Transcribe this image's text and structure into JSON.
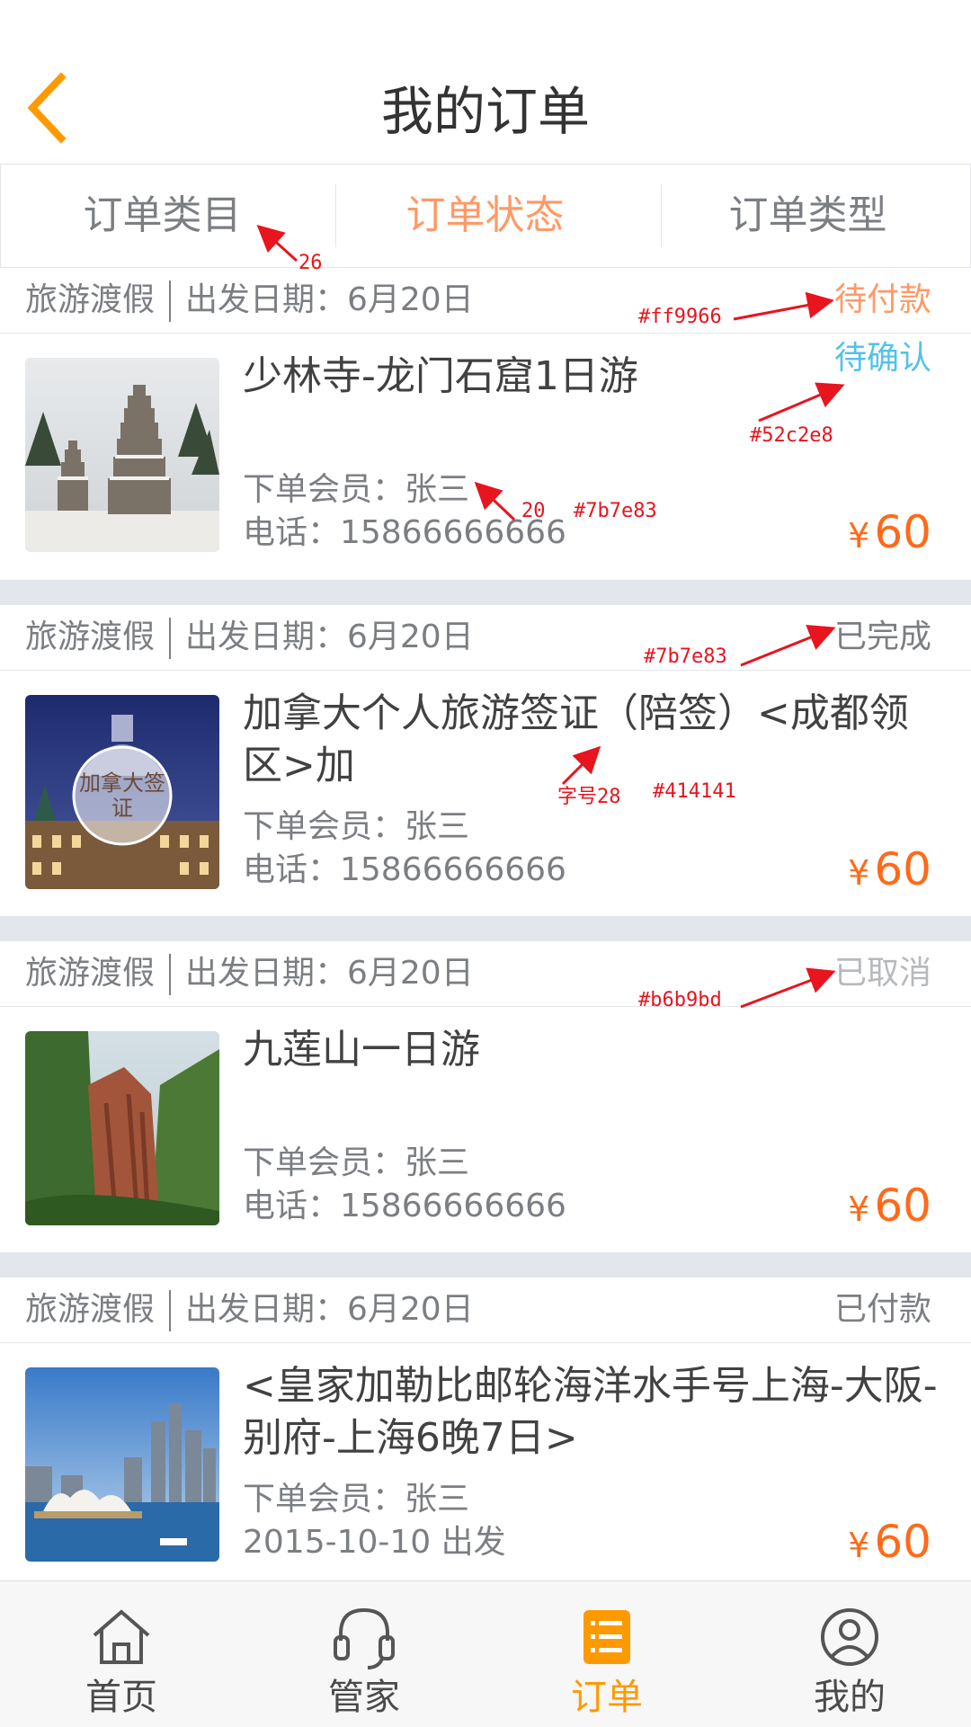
{
  "header": {
    "title": "我的订单",
    "back_icon": "chevron-left-icon"
  },
  "tabs": [
    {
      "label": "订单类目",
      "active": false
    },
    {
      "label": "订单状态",
      "active": true
    },
    {
      "label": "订单类型",
      "active": false
    }
  ],
  "orders": [
    {
      "category": "旅游渡假",
      "date": "出发日期：6月20日",
      "status": "待付款",
      "status_color": "#ff9966",
      "sub_status": "待确认",
      "sub_status_color": "#52c2e8",
      "name": "少林寺-龙门石窟1日游",
      "member": "下单会员：张三",
      "phone": "电话：15866666666",
      "currency": "¥",
      "price": "60"
    },
    {
      "category": "旅游渡假",
      "date": "出发日期：6月20日",
      "status": "已完成",
      "status_color": "#7b7e83",
      "name": "加拿大个人旅游签证（陪签）<成都领区>加",
      "thumb_text": "加拿大签证",
      "member": "下单会员：张三",
      "phone": "电话：15866666666",
      "currency": "¥",
      "price": "60"
    },
    {
      "category": "旅游渡假",
      "date": "出发日期：6月20日",
      "status": "已取消",
      "status_color": "#b6b9bd",
      "name": "九莲山一日游",
      "member": "下单会员：张三",
      "phone": "电话：15866666666",
      "currency": "¥",
      "price": "60"
    },
    {
      "category": "旅游渡假",
      "date": "出发日期：6月20日",
      "status": "已付款",
      "status_color": "#7b7e83",
      "name": "<皇家加勒比邮轮海洋水手号上海-大阪-别府-上海6晚7日>",
      "member": "下单会员：张三",
      "phone": "2015-10-10 出发",
      "currency": "¥",
      "price": "60"
    }
  ],
  "annotations": {
    "tab_font": "26",
    "status_color_1": "#ff9966",
    "sub_status_color": "#52c2e8",
    "member_font": "20",
    "member_color": "#7b7e83",
    "status_color_2": "#7b7e83",
    "name_font": "字号28",
    "name_color": "#414141",
    "status_color_3": "#b6b9bd"
  },
  "tabbar": [
    {
      "label": "首页",
      "icon": "home-icon",
      "active": false
    },
    {
      "label": "管家",
      "icon": "headset-icon",
      "active": false
    },
    {
      "label": "订单",
      "icon": "order-list-icon",
      "active": true
    },
    {
      "label": "我的",
      "icon": "user-icon",
      "active": false
    }
  ],
  "colors": {
    "accent": "#ff9900",
    "price": "#ff6a1a",
    "divider": "#e3e6ec"
  }
}
